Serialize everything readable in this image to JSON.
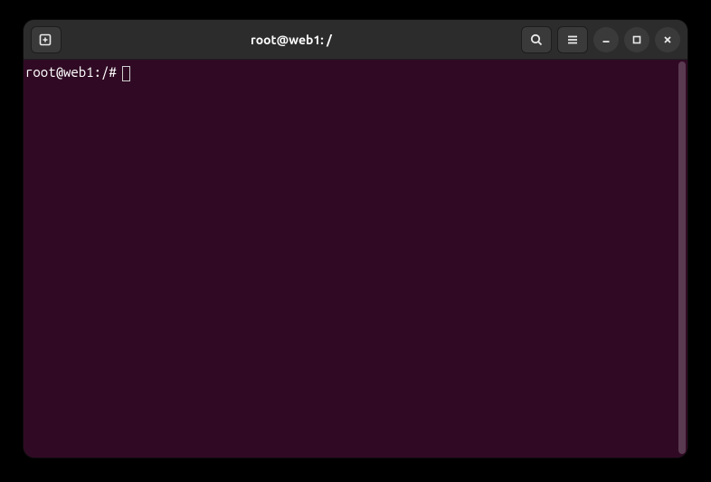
{
  "window": {
    "title": "root@web1: /"
  },
  "titlebar": {
    "buttons": {
      "new_tab": "new-tab",
      "search": "search",
      "menu": "menu",
      "minimize": "minimize",
      "maximize": "maximize",
      "close": "close"
    }
  },
  "terminal": {
    "prompt": "root@web1:/#",
    "input": ""
  }
}
